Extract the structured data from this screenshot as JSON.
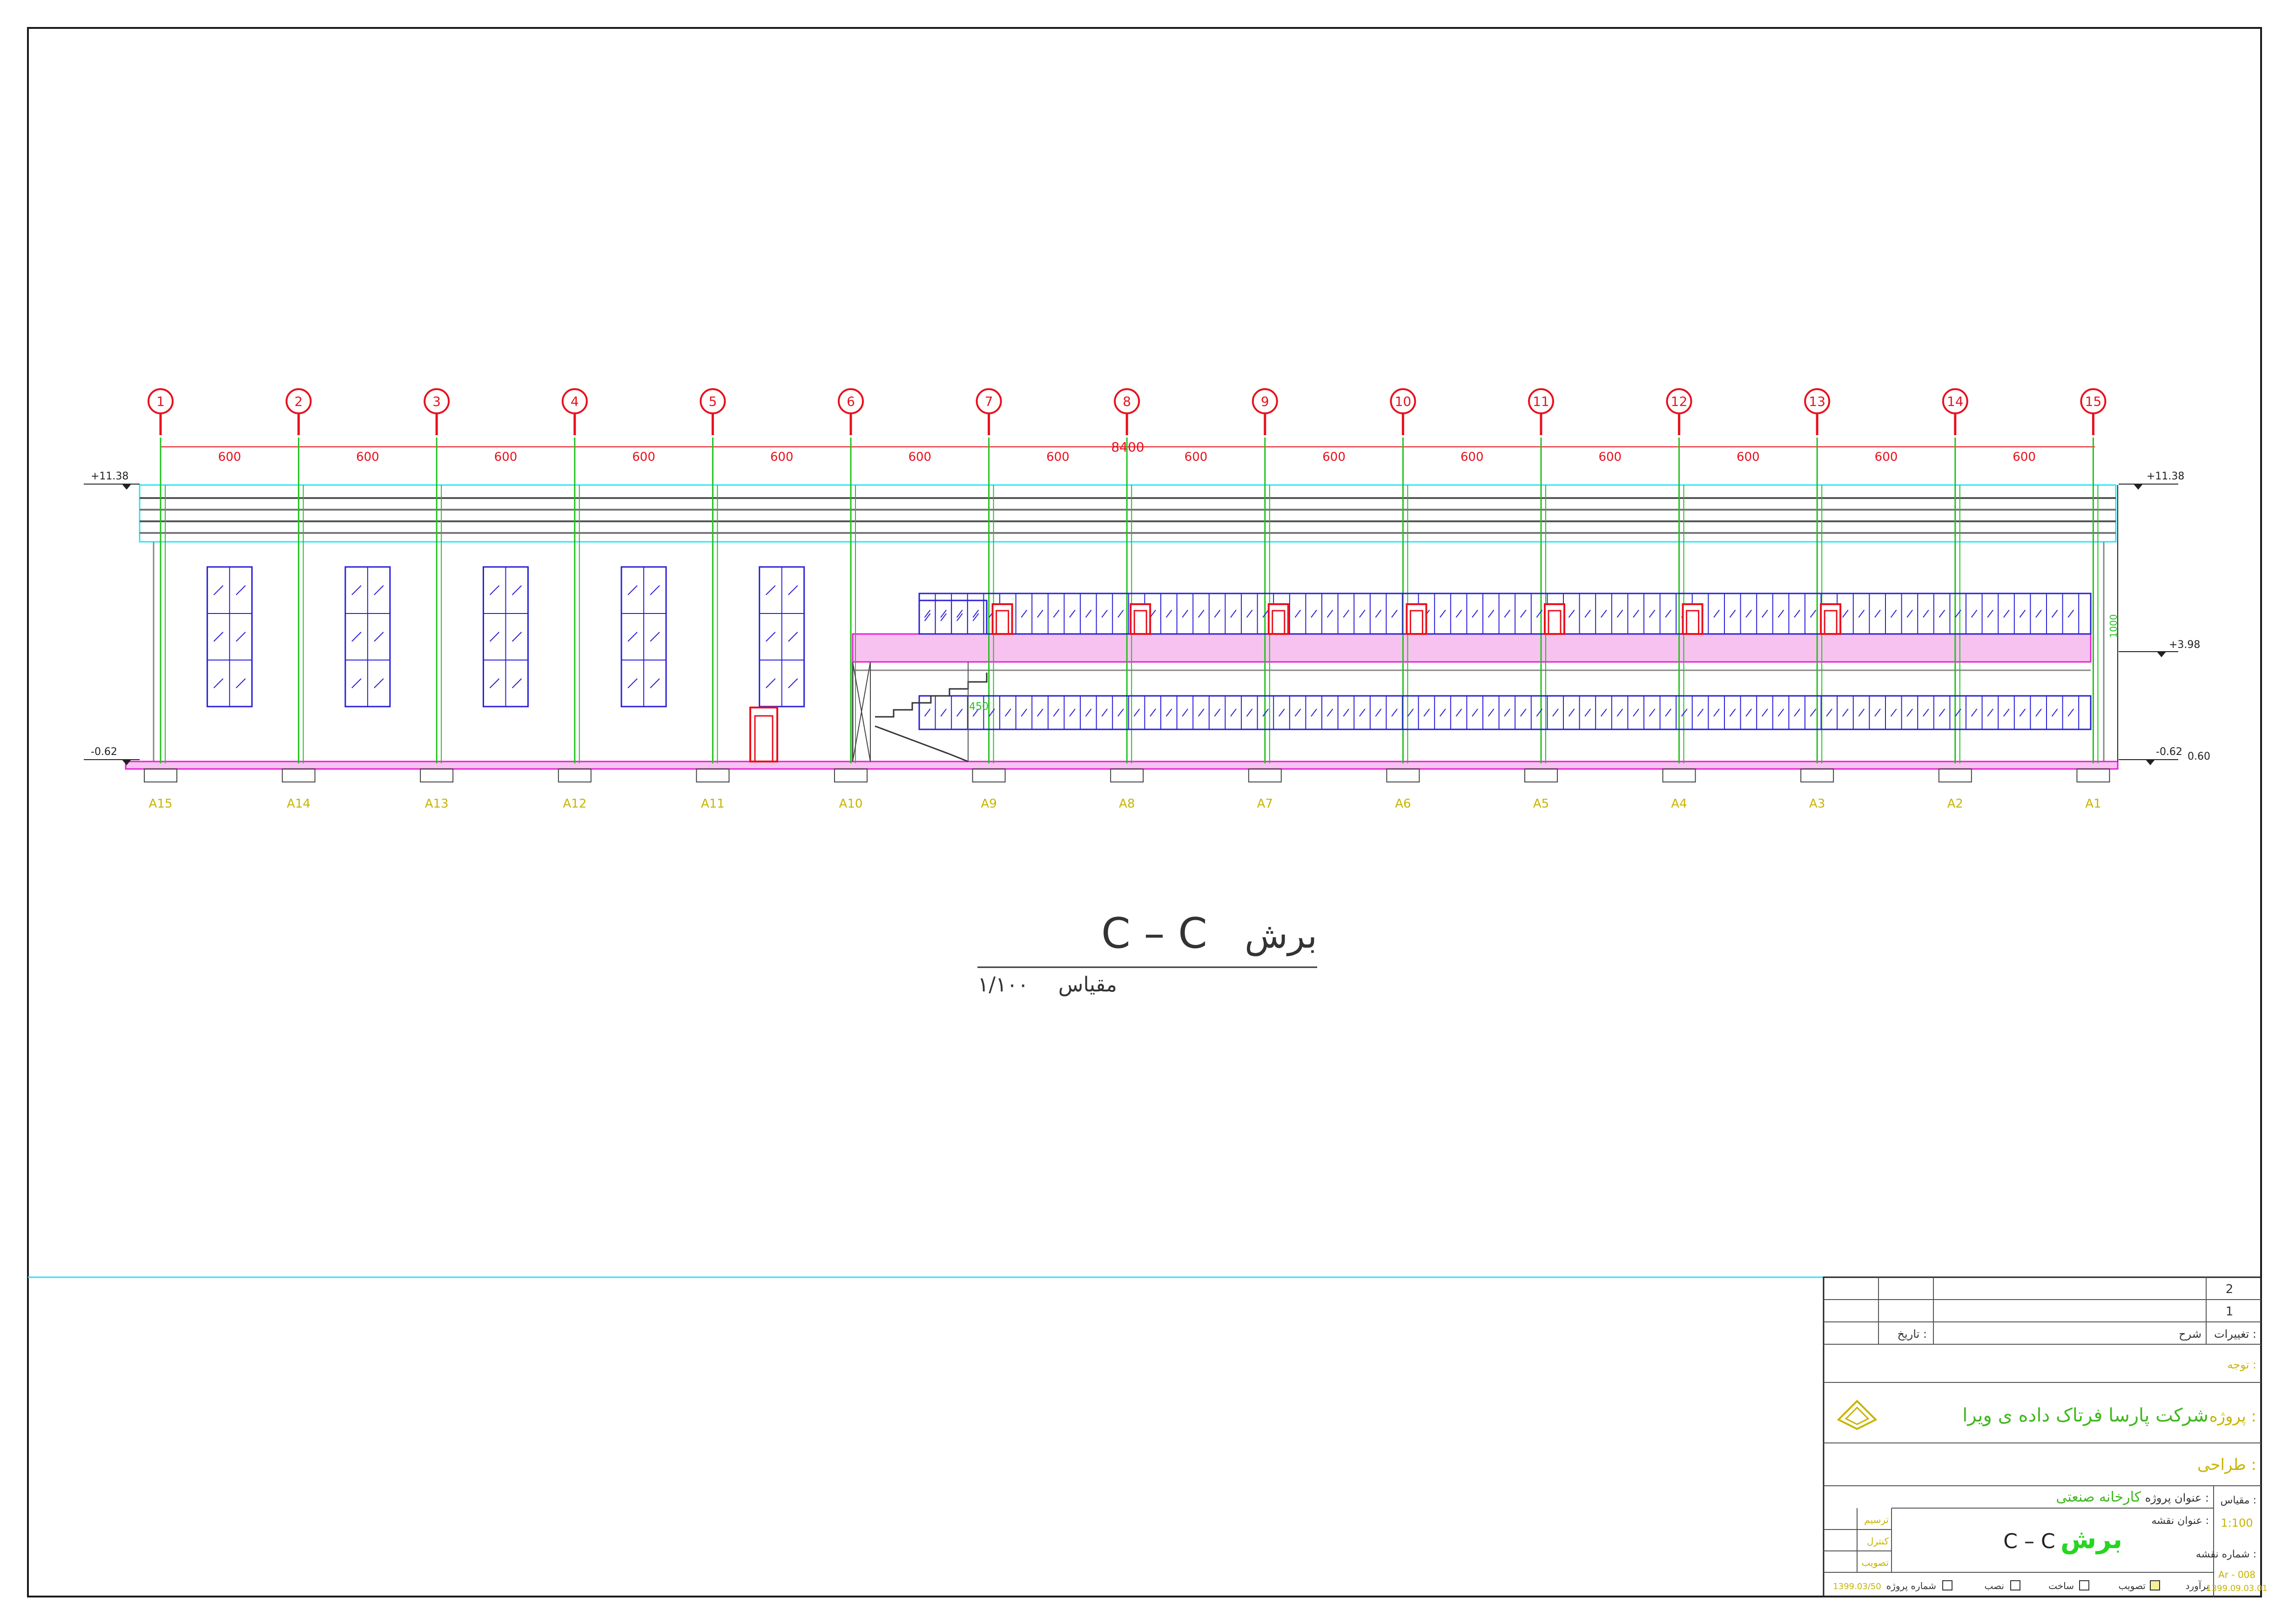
{
  "axes": {
    "numbers": [
      "1",
      "2",
      "3",
      "4",
      "5",
      "6",
      "7",
      "8",
      "9",
      "10",
      "11",
      "12",
      "13",
      "14",
      "15"
    ],
    "bay_labels": [
      "A15",
      "A14",
      "A13",
      "A12",
      "A11",
      "A10",
      "A9",
      "A8",
      "A7",
      "A6",
      "A5",
      "A4",
      "A3",
      "A2",
      "A1"
    ],
    "bay_dimension": "600",
    "total_dimension": "8400"
  },
  "levels": {
    "top_left": "+11.38",
    "top_right": "+11.38",
    "mid_right": "+3.98",
    "bottom_left": "-0.62",
    "bottom_right_1": "-0.62",
    "bottom_right_2": "0.60",
    "height_note": "1000",
    "stair_note": "450"
  },
  "section": {
    "word": "برش",
    "label": "C – C",
    "scale_word": "مقیاس",
    "scale_value": "۱/۱۰۰"
  },
  "title_block": {
    "rev_2": "2",
    "rev_1": "1",
    "changes_label": "تغییرات :",
    "description_label": "شرح",
    "date_label": "تاریخ :",
    "notes_label": "توجه :",
    "project_owner_label": "پروژه :",
    "company_name": "شرکت پارسا فرتاک داده ی ویرا",
    "designer_label": "طراحی :",
    "scale_label": "مقیاس :",
    "scale_value": "1:100",
    "project_title_label": "عنوان پروژه :",
    "project_title_value": "کارخانه صنعتی",
    "sheet_title_label": "عنوان نقشه :",
    "sheet_title_word": "برش",
    "sheet_title_value": "C – C",
    "drawn_label": "ترسیم",
    "checked_label": "کنترل",
    "approved_label": "تصویب",
    "sheet_number_label": "شماره نقشه :",
    "sheet_number_value": "Ar - 008",
    "sheet_date": "1399.09.03.01",
    "project_number_label": "شماره پروژه",
    "project_number_value": "1399.03/50",
    "status_preliminary": "برآورد",
    "status_approval": "تصویب",
    "status_construction": "ساخت",
    "status_installation": "نصب"
  },
  "colors": {
    "grid_marker": "#e8101c",
    "column": "#22c21e",
    "roof": "#2ee5ef",
    "window": "#2a1fd8",
    "floor": "#e81fd6",
    "door": "#e8101c",
    "title_text": "#c8b400",
    "company_text": "#3fb81e",
    "sheet_title_green": "#26d620"
  }
}
